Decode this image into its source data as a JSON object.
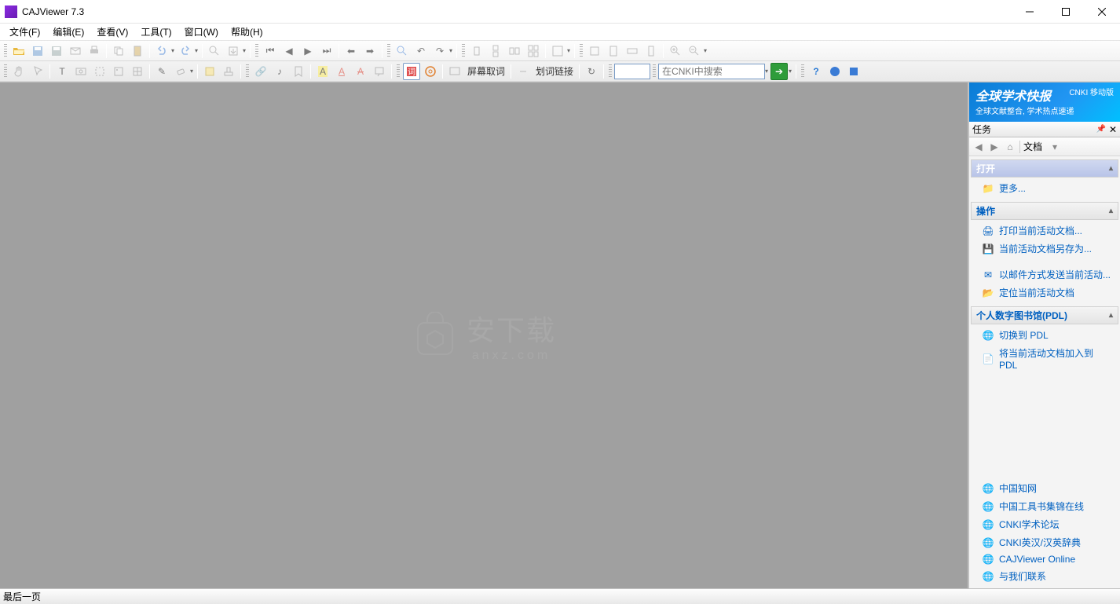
{
  "window": {
    "title": "CAJViewer 7.3"
  },
  "menu": {
    "file": "文件(F)",
    "edit": "编辑(E)",
    "view": "查看(V)",
    "tools": "工具(T)",
    "window": "窗口(W)",
    "help": "帮助(H)"
  },
  "toolbar": {
    "screen_query": "屏幕取词",
    "word_link": "划词链接",
    "search_placeholder": "在CNKI中搜索"
  },
  "banner": {
    "line1": "全球学术快报",
    "cnki": "CNKI 移动版",
    "line2": "全球文献整合, 学术热点速递"
  },
  "task_panel": {
    "title": "任务",
    "tab": "文档",
    "open_header": "打开",
    "more": "更多...",
    "ops_header": "操作",
    "ops": {
      "print": "打印当前活动文档...",
      "saveas": "当前活动文档另存为...",
      "mail": "以邮件方式发送当前活动...",
      "locate": "定位当前活动文档"
    },
    "pdl_header": "个人数字图书馆(PDL)",
    "pdl": {
      "switch": "切换到 PDL",
      "add": "将当前活动文档加入到 PDL"
    },
    "links": {
      "cnki": "中国知网",
      "toolbook": "中国工具书集锦在线",
      "forum": "CNKI学术论坛",
      "dict": "CNKI英汉/汉英辞典",
      "online": "CAJViewer Online",
      "contact": "与我们联系"
    }
  },
  "status": {
    "text": "最后一页"
  },
  "watermark": {
    "text": "安下载",
    "sub": "anxz.com"
  }
}
